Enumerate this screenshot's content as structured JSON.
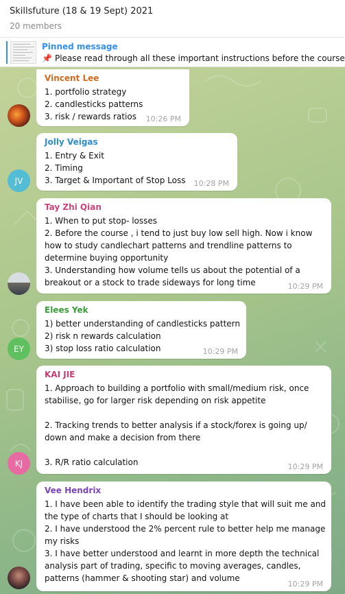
{
  "header": {
    "title": "Skillsfuture (18 & 19 Sept) 2021",
    "members": "20 members"
  },
  "pinned": {
    "title": "Pinned message",
    "text": "Please read through all these important instructions before the course:"
  },
  "messages": [
    {
      "sender": "Vincent Lee",
      "color": "#d2691e",
      "lines": [
        "1. portfolio strategy",
        "2. candlesticks patterns",
        "3. risk  / rewards ratios"
      ],
      "time": "10:26 PM",
      "avatar_initials": ""
    },
    {
      "sender": "Jolly Veigas",
      "color": "#2f8cc5",
      "lines": [
        "1. Entry & Exit",
        "2. Timing",
        "3. Target & Important of Stop Loss"
      ],
      "time": "10:28 PM",
      "avatar_initials": "JV",
      "avatar_color": "#55bcd6"
    },
    {
      "sender": "Tay Zhi Qian",
      "color": "#c74579",
      "lines": [
        "1. When to put stop- losses",
        "2. Before the course , i tend to just buy low sell high. Now i know",
        "how to study candlechart patterns and trendline patterns to",
        "determine buying opportunity",
        "3. Understanding how volume tells us about the potential of a",
        "breakout or a stock to trade sideways for long time"
      ],
      "time": "10:29 PM",
      "avatar_initials": ""
    },
    {
      "sender": "Elees Yek",
      "color": "#3a9b3a",
      "lines": [
        "1) better understanding of candlesticks pattern",
        "2) risk n rewards calculation",
        "3) stop loss ratio calculation"
      ],
      "time": "10:29 PM",
      "avatar_initials": "EY",
      "avatar_color": "#5ec05e"
    },
    {
      "sender": "KAI JIE",
      "color": "#c43d72",
      "lines": [
        "1. Approach to building a portfolio with small/medium risk, once",
        "stabilise, go for larger risk depending on risk appetite",
        "",
        "2. Tracking trends to better analysis if a stock/forex is going up/",
        "down and make a decision from there",
        "",
        "3. R/R ratio calculation"
      ],
      "time": "10:29 PM",
      "avatar_initials": "KJ",
      "avatar_color": "#e86aa2"
    },
    {
      "sender": "Vee Hendrix",
      "color": "#7b45b8",
      "lines": [
        "1. I have been able to identify the trading style that will suit me and",
        "the type of charts that I should be looking at",
        "2. I have understood the 2% percent rule to better help me manage",
        "my risks",
        "3. I have better understood and learnt in more depth the technical",
        "analysis part of trading, specific to moving averages, candles,",
        "patterns (hammer & shooting star) and volume"
      ],
      "time": "10:29 PM",
      "avatar_initials": ""
    }
  ]
}
